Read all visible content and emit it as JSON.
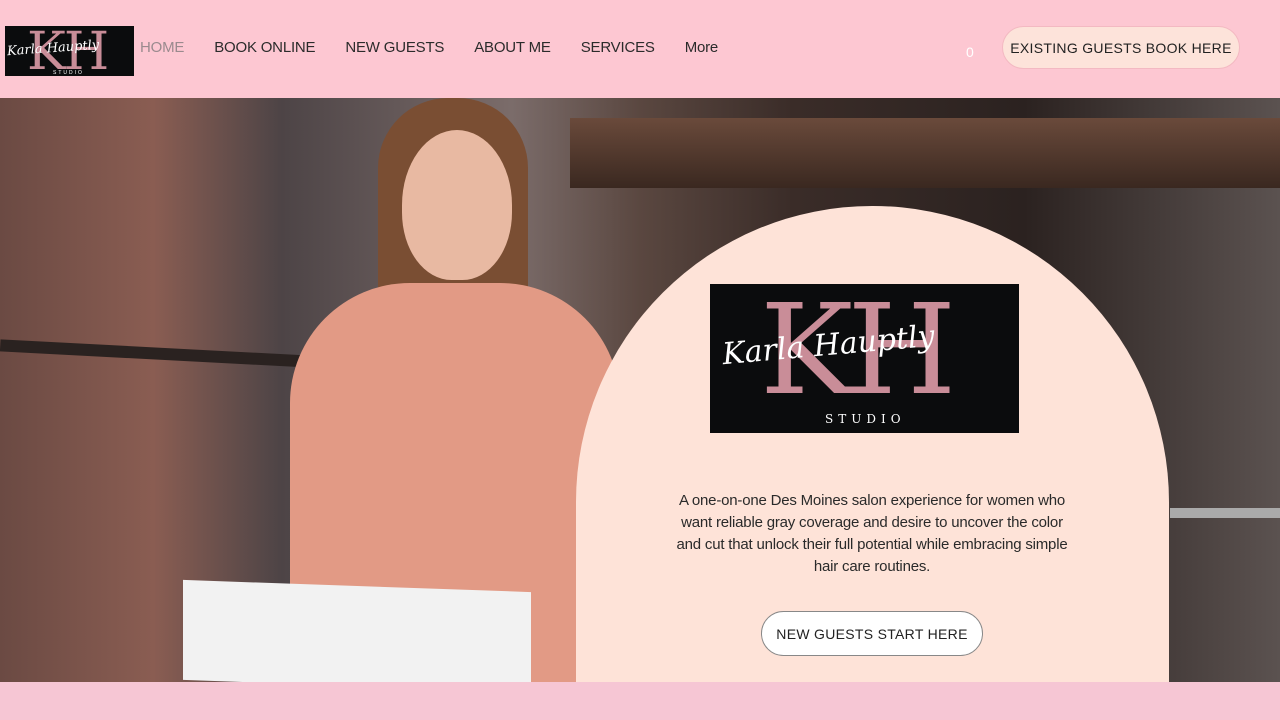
{
  "header": {
    "logo": {
      "monogram": "KH",
      "script": "Karla Hauptly",
      "studio": "STUDIO"
    },
    "nav": [
      {
        "label": "HOME",
        "active": true
      },
      {
        "label": "BOOK ONLINE",
        "active": false
      },
      {
        "label": "NEW GUESTS",
        "active": false
      },
      {
        "label": "ABOUT ME",
        "active": false
      },
      {
        "label": "SERVICES",
        "active": false
      },
      {
        "label": "More",
        "active": false
      }
    ],
    "cart_count": "0",
    "cta_label": "EXISTING GUESTS BOOK HERE"
  },
  "hero": {
    "logo": {
      "monogram": "KH",
      "script": "Karla Hauptly",
      "studio": "STUDIO"
    },
    "tagline": "A one-on-one Des Moines salon experience for women who want reliable gray coverage and desire to uncover the color and cut that unlock their full potential while embracing simple hair care routines.",
    "cta_label": "NEW GUESTS START HERE"
  },
  "colors": {
    "header_bg": "#fdc7d2",
    "arch_bg": "#fee3d8",
    "logo_bg": "#0b0c0d",
    "logo_accent": "#c98d98"
  }
}
